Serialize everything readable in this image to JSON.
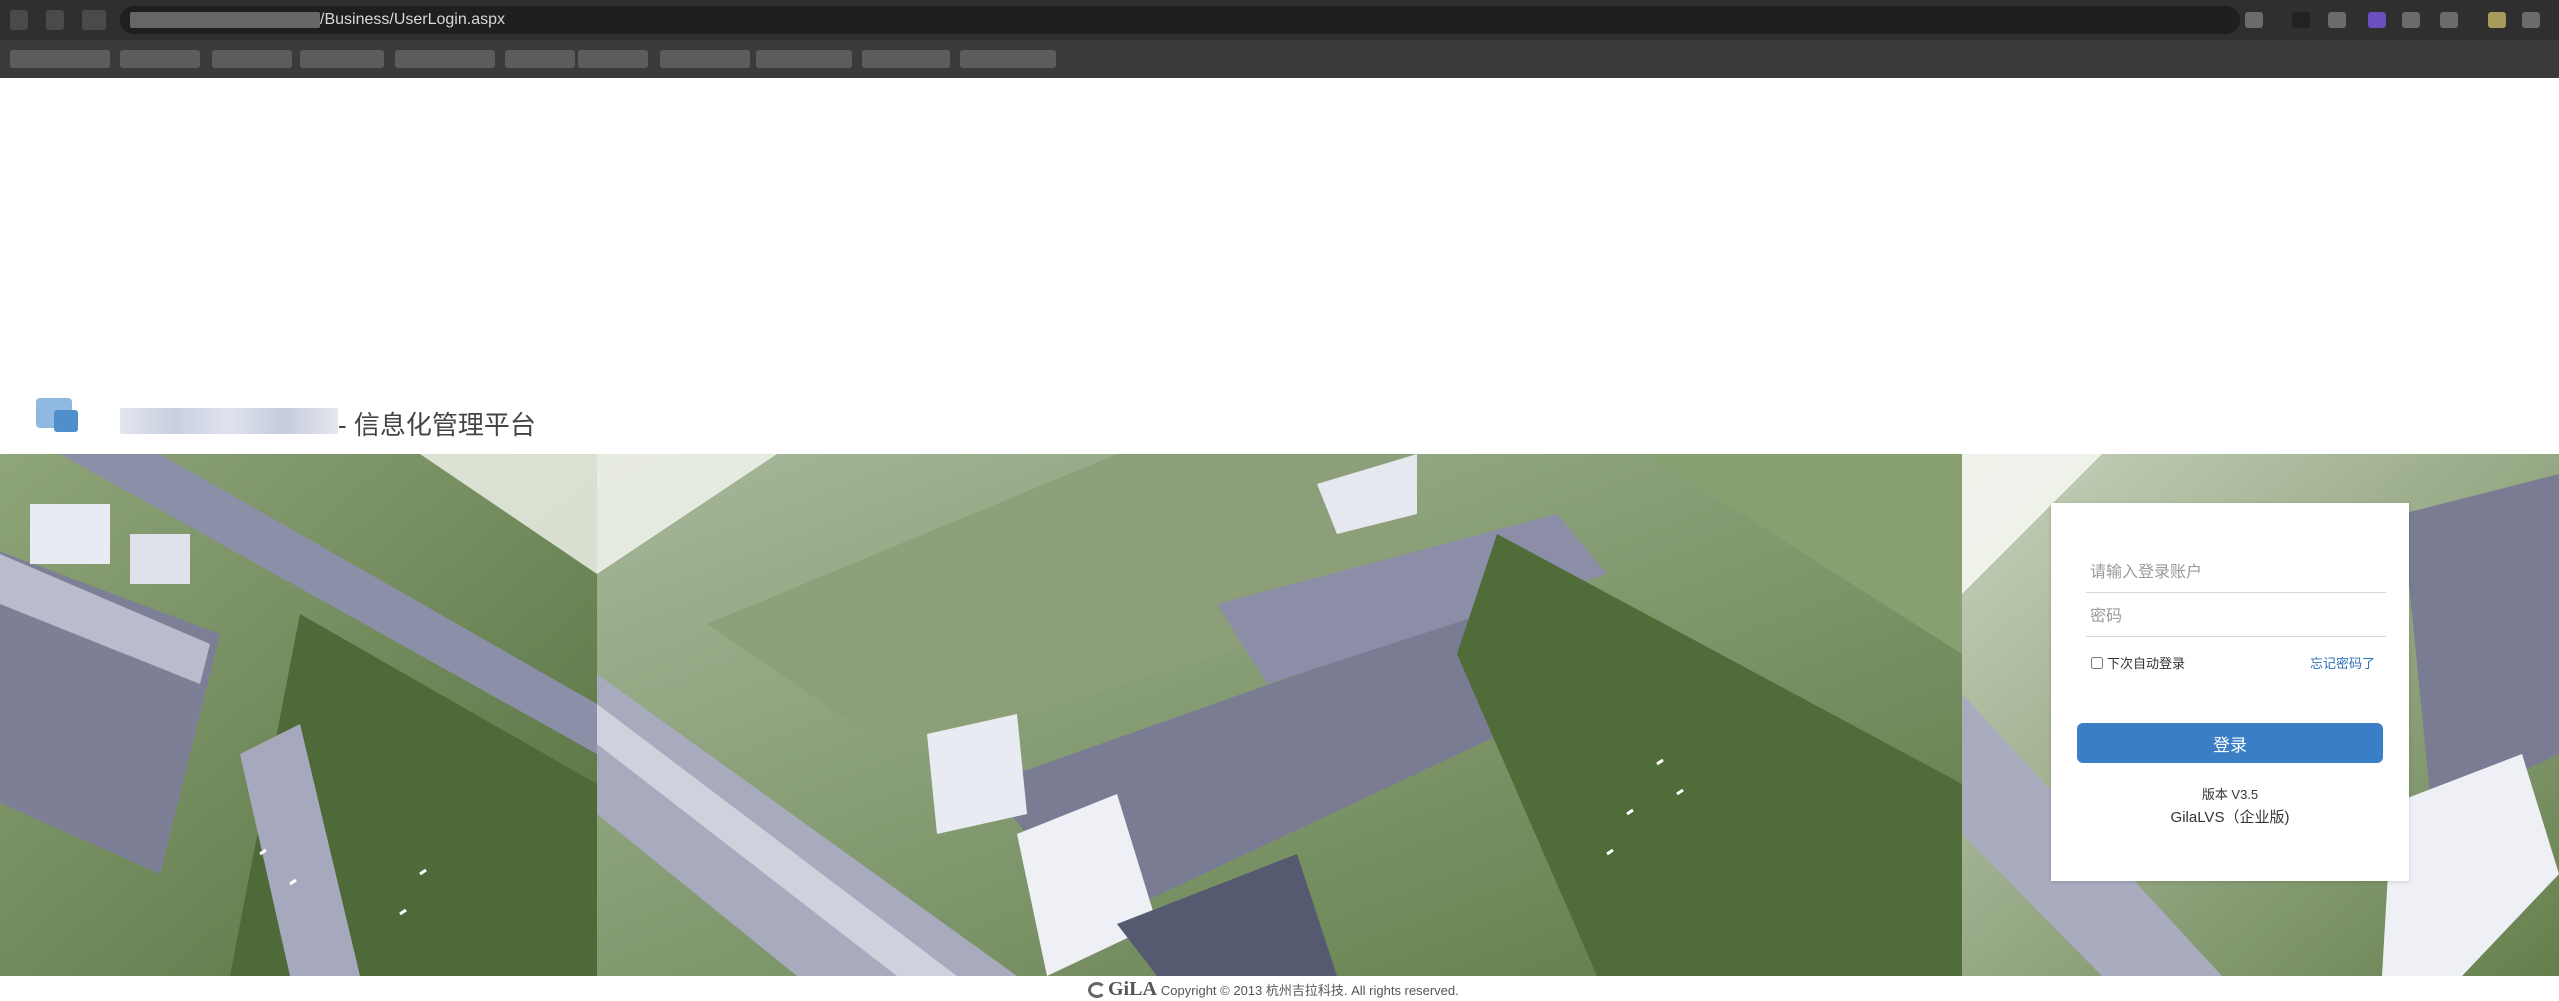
{
  "browser": {
    "url_suffix": "/Business/UserLogin.aspx"
  },
  "header": {
    "platform_title": "- 信息化管理平台"
  },
  "login": {
    "username_placeholder": "请输入登录账户",
    "password_placeholder": "密码",
    "remember_label": "下次自动登录",
    "forgot_label": "忘记密码了",
    "login_button": "登录",
    "version": "版本 V3.5",
    "edition": "GilaLVS（企业版)"
  },
  "footer": {
    "logo_text": "GiLA",
    "copyright": "Copyright © 2013 杭州吉拉科技. All rights reserved."
  },
  "colors": {
    "login_button": "#3a7ec6",
    "forgot_link": "#2d6fb8",
    "chrome_bg": "#3a3a3a"
  }
}
